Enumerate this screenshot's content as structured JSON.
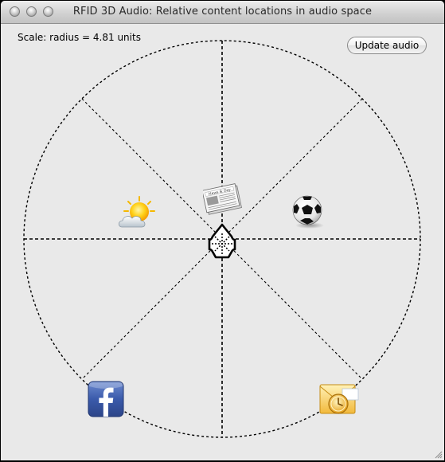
{
  "window": {
    "title": "RFID 3D Audio: Relative content locations in audio space"
  },
  "scale": {
    "label": "Scale: radius = 4.81 units"
  },
  "toolbar": {
    "update_label": "Update audio"
  },
  "audio_space": {
    "icons": [
      {
        "name": "weather-icon"
      },
      {
        "name": "newspaper-icon"
      },
      {
        "name": "soccer-ball-icon"
      },
      {
        "name": "facebook-icon"
      },
      {
        "name": "outlook-icon"
      },
      {
        "name": "listener-head-icon"
      }
    ],
    "newspaper_text": "News & Day"
  }
}
